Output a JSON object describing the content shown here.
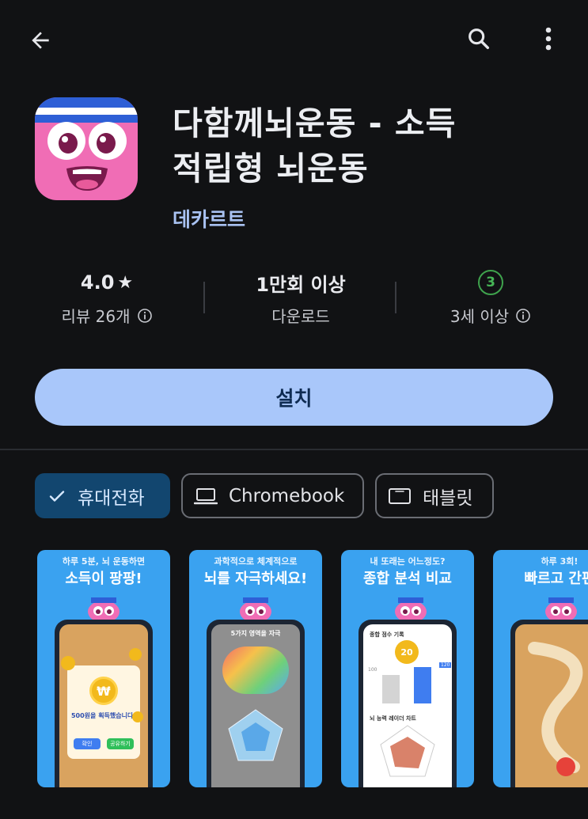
{
  "header": {
    "back_icon": "arrow-back-icon",
    "search_icon": "search-icon",
    "more_icon": "more-vert-icon"
  },
  "app": {
    "title_line1": "다함께뇌운동 - 소득",
    "title_line2": "적립형 뇌운동",
    "developer": "데카르트"
  },
  "stats": {
    "rating": "4.0",
    "rating_star": "★",
    "reviews": "리뷰 26개",
    "downloads": "1만회 이상",
    "downloads_label": "다운로드",
    "age_badge": "3",
    "age_label": "3세 이상"
  },
  "install_label": "설치",
  "device_chips": [
    {
      "label": "휴대전화",
      "selected": true
    },
    {
      "label": "Chromebook",
      "selected": false
    },
    {
      "label": "태블릿",
      "selected": false
    }
  ],
  "screenshots": [
    {
      "caption_small": "하루 5분, 뇌 운동하면",
      "caption_large": "소득이 팡팡!",
      "coin_text": "500원을 획득했습니다!",
      "btn_confirm": "확인",
      "btn_share": "공유하기"
    },
    {
      "caption_small": "과학적으로 체계적으로",
      "caption_large": "뇌를 자극하세요!",
      "top_text": "5가지 영역을 자극"
    },
    {
      "caption_small": "내 또래는 어느정도?",
      "caption_large": "종합 분석 비교",
      "record": "종합 점수 기록",
      "badge": "20",
      "val1": "100",
      "val2": "120",
      "radar_title": "뇌 능력 레이더 차트"
    },
    {
      "caption_small": "하루 3회!",
      "caption_large": "빠르고 간편"
    }
  ],
  "colors": {
    "background": "#111214",
    "accent": "#a9c7fa",
    "developer_link": "#a9c2f2",
    "selected_chip": "#12466f",
    "age_badge": "#3fa34d"
  }
}
